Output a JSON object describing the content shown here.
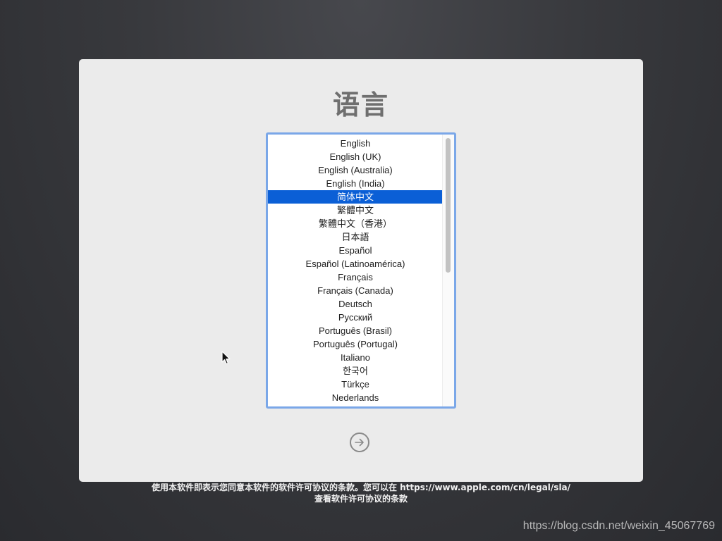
{
  "page": {
    "title": "语言"
  },
  "language_list": {
    "selected_index": 4,
    "items": [
      "English",
      "English (UK)",
      "English (Australia)",
      "English (India)",
      "简体中文",
      "繁體中文",
      "繁體中文（香港）",
      "日本語",
      "Español",
      "Español (Latinoamérica)",
      "Français",
      "Français (Canada)",
      "Deutsch",
      "Русский",
      "Português (Brasil)",
      "Português (Portugal)",
      "Italiano",
      "한국어",
      "Türkçe",
      "Nederlands"
    ]
  },
  "next_button": {
    "icon": "arrow-right-circle-icon"
  },
  "footer": {
    "line1": "使用本软件即表示您同意本软件的软件许可协议的条款。您可以在 https://www.apple.com/cn/legal/sla/",
    "line2": "查看软件许可协议的条款"
  },
  "watermark": "https://blog.csdn.net/weixin_45067769",
  "colors": {
    "selection": "#0b5fd6",
    "focus_ring": "#7aa7e8",
    "panel": "#ebebeb"
  }
}
